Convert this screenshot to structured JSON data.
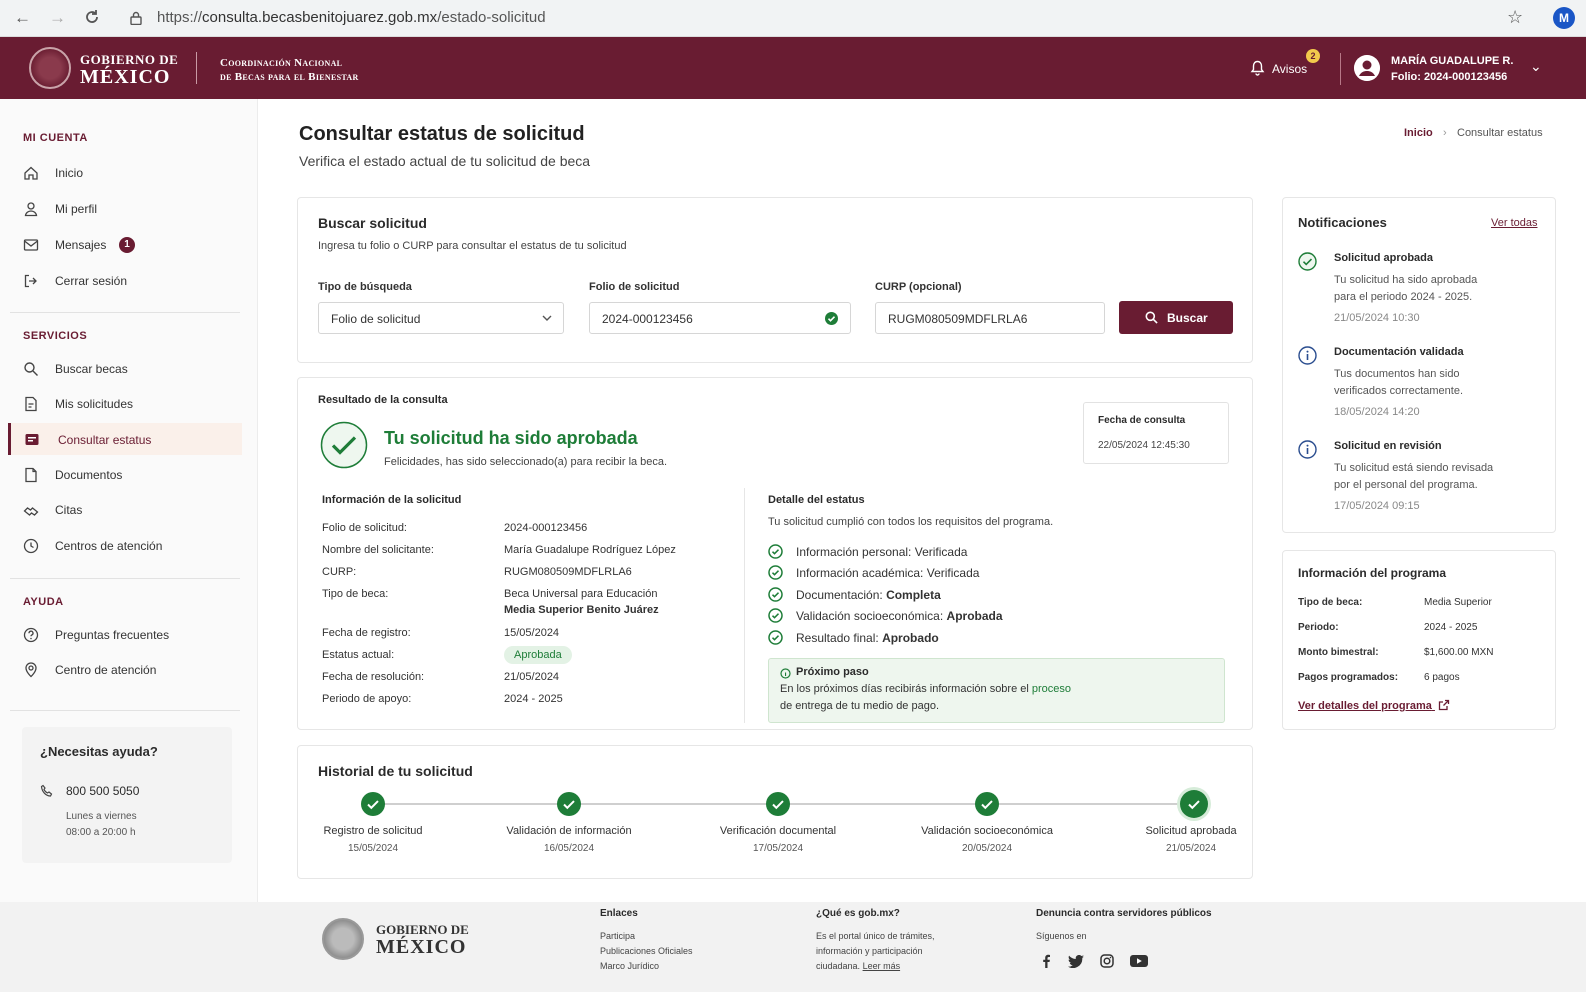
{
  "browser": {
    "url_prefix": "https://",
    "url_domain": "consulta.becasbenitojuarez.gob.mx",
    "url_path": "/estado-solicitud",
    "profile": "M"
  },
  "header": {
    "gob_line1": "GOBIERNO DE",
    "gob_line2": "MÉXICO",
    "coord_line1": "Coordinación Nacional",
    "coord_line2": "de Becas para el Bienestar",
    "avisos_label": "Avisos",
    "avisos_count": "2",
    "user_name": "MARÍA GUADALUPE R.",
    "user_folio": "Folio: 2024-000123456"
  },
  "sidebar": {
    "sec_cuenta": "MI CUENTA",
    "cuenta": [
      {
        "label": "Inicio"
      },
      {
        "label": "Mi perfil"
      },
      {
        "label": "Mensajes",
        "badge": "1"
      },
      {
        "label": "Cerrar sesión"
      }
    ],
    "sec_servicios": "SERVICIOS",
    "servicios": [
      {
        "label": "Buscar becas"
      },
      {
        "label": "Mis solicitudes"
      },
      {
        "label": "Consultar estatus"
      },
      {
        "label": "Documentos"
      },
      {
        "label": "Citas"
      },
      {
        "label": "Centros de atención"
      }
    ],
    "sec_ayuda": "AYUDA",
    "ayuda": [
      {
        "label": "Preguntas frecuentes"
      },
      {
        "label": "Centro de atención"
      }
    ],
    "help_title": "¿Necesitas ayuda?",
    "help_phone": "800 500 5050",
    "help_days": "Lunes a viernes",
    "help_hours": "08:00 a 20:00 h"
  },
  "page": {
    "title": "Consultar estatus de solicitud",
    "subtitle": "Verifica el estado actual de tu solicitud de beca",
    "breadcrumb_home": "Inicio",
    "breadcrumb_sep": "›",
    "breadcrumb_current": "Consultar estatus"
  },
  "search": {
    "title": "Buscar solicitud",
    "desc": "Ingresa tu folio o CURP para consultar el estatus de tu solicitud",
    "type_label": "Tipo de búsqueda",
    "type_value": "Folio de solicitud",
    "folio_label": "Folio de solicitud",
    "folio_value": "2024-000123456",
    "curp_label": "CURP (opcional)",
    "curp_value": "RUGM080509MDFLRLA6",
    "button": "Buscar"
  },
  "result": {
    "title": "Resultado de la consulta",
    "headline": "Tu solicitud ha sido aprobada",
    "message": "Felicidades, has sido seleccionado(a) para recibir la beca.",
    "fecha_label": "Fecha de consulta",
    "fecha_value": "22/05/2024 12:45:30",
    "info_title": "Información de la solicitud",
    "info": [
      {
        "k": "Folio de solicitud:",
        "v": "2024-000123456"
      },
      {
        "k": "Nombre del solicitante:",
        "v": "María Guadalupe Rodríguez López"
      },
      {
        "k": "CURP:",
        "v": "RUGM080509MDFLRLA6"
      },
      {
        "k": "Tipo de beca:",
        "v": "Beca Universal para Educación",
        "v2": "Media Superior Benito Juárez"
      },
      {
        "k": "Fecha de registro:",
        "v": "15/05/2024"
      },
      {
        "k": "Estatus actual:",
        "v": "Aprobada"
      },
      {
        "k": "Fecha de resolución:",
        "v": "21/05/2024"
      },
      {
        "k": "Periodo de apoyo:",
        "v": "2024 - 2025"
      }
    ],
    "detail_title": "Detalle del estatus",
    "detail_desc": "Tu solicitud cumplió con todos los requisitos del programa.",
    "checks": [
      {
        "k": "Información personal:",
        "v": "Verificada",
        "bold": false
      },
      {
        "k": "Información académica:",
        "v": "Verificada",
        "bold": false
      },
      {
        "k": "Documentación:",
        "v": "Completa",
        "bold": true
      },
      {
        "k": "Validación socioeconómica:",
        "v": "Aprobada",
        "bold": true
      },
      {
        "k": "Resultado final:",
        "v": "Aprobado",
        "bold": true
      }
    ],
    "next_title": "Próximo paso",
    "next_line1a": "En los próximos días recibirás información sobre el ",
    "next_link": "proceso",
    "next_line2": "de entrega de tu medio de pago."
  },
  "history": {
    "title": "Historial de tu solicitud",
    "steps": [
      {
        "label": "Registro de solicitud",
        "date": "15/05/2024"
      },
      {
        "label": "Validación de información",
        "date": "16/05/2024"
      },
      {
        "label": "Verificación documental",
        "date": "17/05/2024"
      },
      {
        "label": "Validación socioeconómica",
        "date": "20/05/2024"
      },
      {
        "label": "Solicitud aprobada",
        "date": "21/05/2024"
      }
    ]
  },
  "notifications": {
    "title": "Notificaciones",
    "ver_todas": "Ver todas",
    "items": [
      {
        "title": "Solicitud aprobada",
        "l1": "Tu solicitud ha sido aprobada",
        "l2": "para el periodo 2024 - 2025.",
        "date": "21/05/2024 10:30"
      },
      {
        "title": "Documentación validada",
        "l1": "Tus documentos han sido",
        "l2": "verificados correctamente.",
        "date": "18/05/2024 14:20"
      },
      {
        "title": "Solicitud en revisión",
        "l1": "Tu solicitud está siendo revisada",
        "l2": "por el personal del programa.",
        "date": "17/05/2024 09:15"
      }
    ]
  },
  "program": {
    "title": "Información del programa",
    "rows": [
      {
        "k": "Tipo de beca:",
        "v": "Media Superior"
      },
      {
        "k": "Periodo:",
        "v": "2024 - 2025"
      },
      {
        "k": "Monto bimestral:",
        "v": "$1,600.00 MXN"
      },
      {
        "k": "Pagos programados:",
        "v": "6 pagos"
      }
    ],
    "link": "Ver detalles del programa"
  },
  "footer": {
    "gob1": "GOBIERNO DE",
    "gob2": "MÉXICO",
    "enlaces_title": "Enlaces",
    "enlaces": [
      "Participa",
      "Publicaciones Oficiales",
      "Marco Jurídico"
    ],
    "que_title": "¿Qué es gob.mx?",
    "que_l1": "Es el portal único de trámites,",
    "que_l2": "información y participación",
    "que_l3": "ciudadana.",
    "que_link": "Leer más",
    "denuncia_title": "Denuncia contra servidores públicos",
    "siguenos": "Síguenos en"
  },
  "colors": {
    "brand": "#691c32",
    "success": "#1e7d38"
  }
}
